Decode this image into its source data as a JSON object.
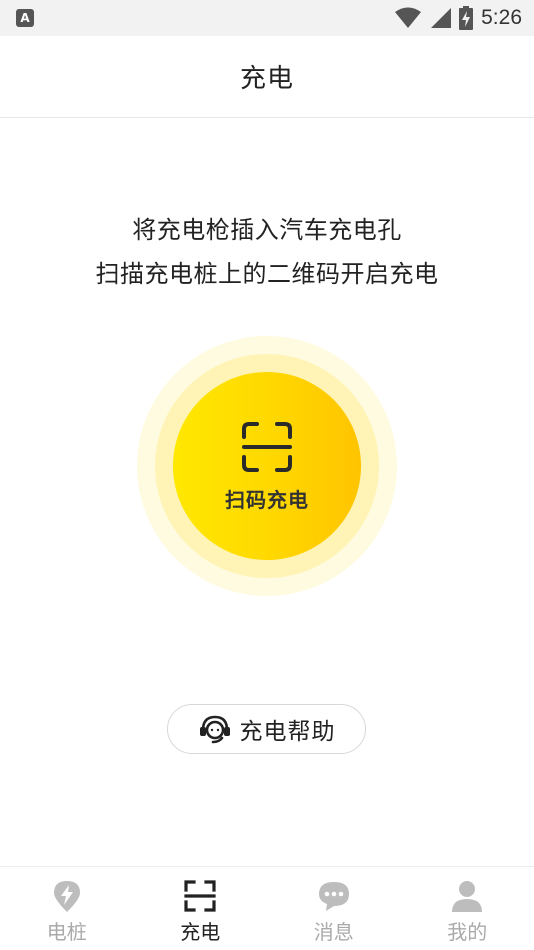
{
  "status_bar": {
    "notification_icon": "A",
    "time": "5:26",
    "icons": [
      "wifi-icon",
      "signal-icon",
      "battery-charging-icon"
    ]
  },
  "header": {
    "title": "充电"
  },
  "instructions": {
    "line1": "将充电枪插入汽车充电孔",
    "line2": "扫描充电桩上的二维码开启充电"
  },
  "scan_button": {
    "label": "扫码充电",
    "icon": "scan-icon"
  },
  "help_button": {
    "label": "充电帮助",
    "icon": "headset-icon"
  },
  "bottom_nav": {
    "items": [
      {
        "label": "电桩",
        "icon": "lightning-pin-icon",
        "active": false
      },
      {
        "label": "充电",
        "icon": "scan-icon",
        "active": true
      },
      {
        "label": "消息",
        "icon": "chat-bubble-icon",
        "active": false
      },
      {
        "label": "我的",
        "icon": "user-icon",
        "active": false
      }
    ]
  },
  "colors": {
    "accent": "#ffd700",
    "glow": "#fff4b5",
    "inactive": "#aaaaaa",
    "active": "#222222"
  }
}
